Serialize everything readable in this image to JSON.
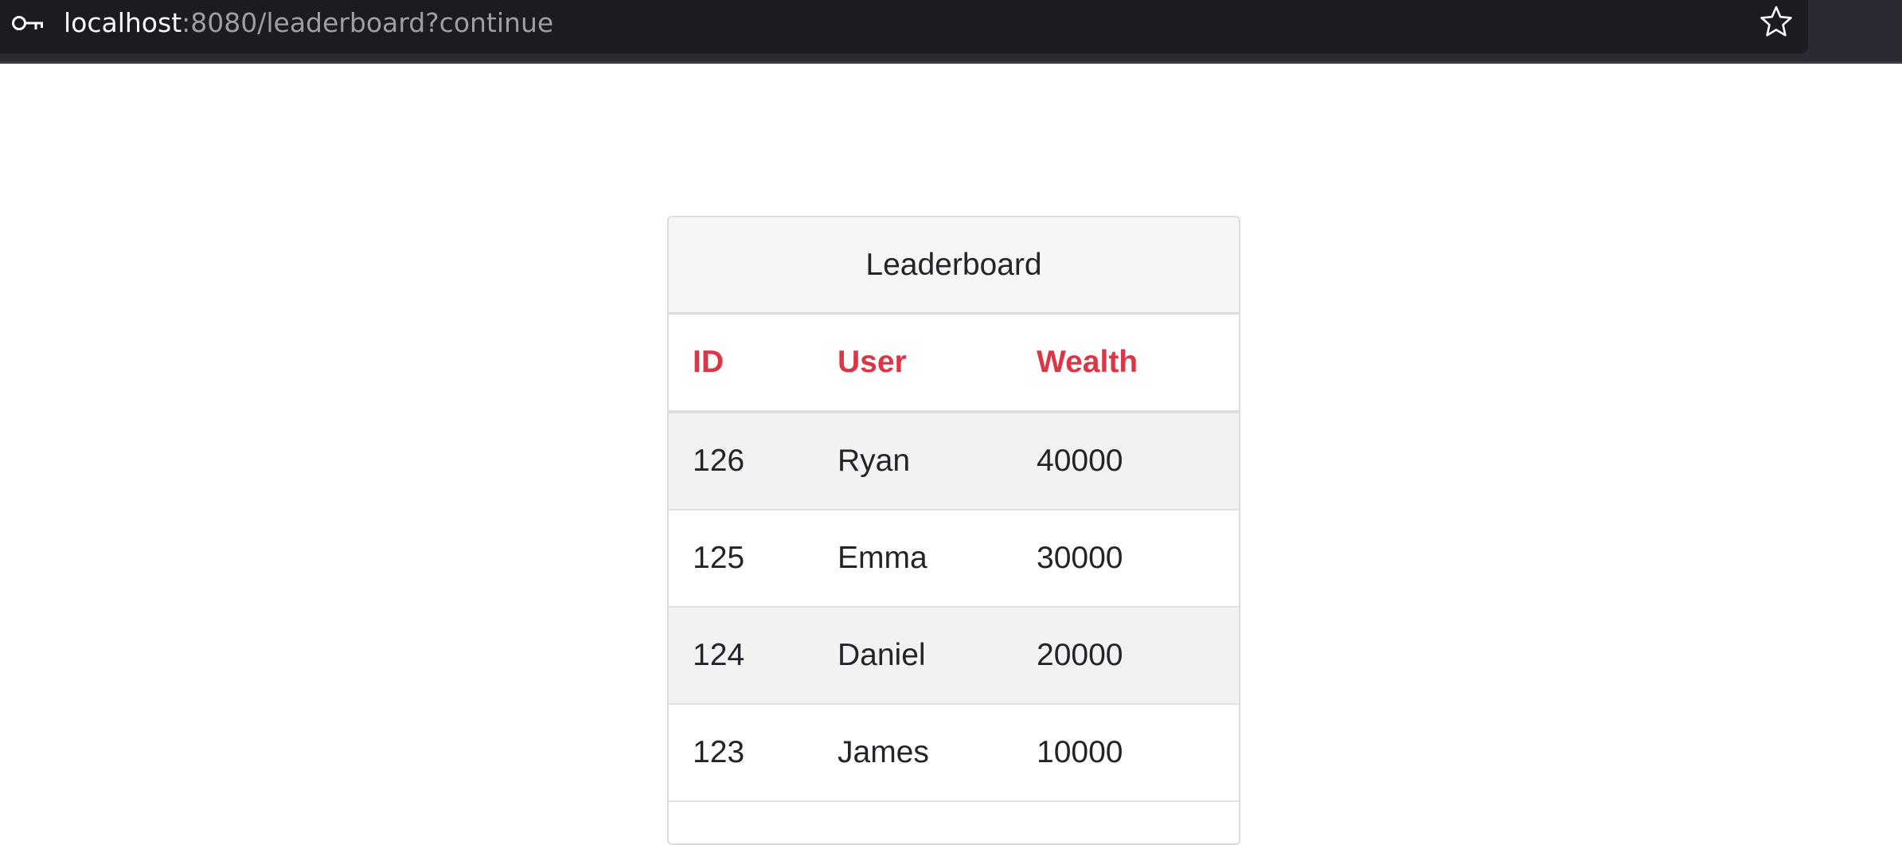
{
  "browser": {
    "url_host": "localhost",
    "url_rest": ":8080/leaderboard?continue"
  },
  "leaderboard": {
    "title": "Leaderboard",
    "columns": [
      "ID",
      "User",
      "Wealth"
    ],
    "rows": [
      {
        "id": "126",
        "user": "Ryan",
        "wealth": "40000"
      },
      {
        "id": "125",
        "user": "Emma",
        "wealth": "30000"
      },
      {
        "id": "124",
        "user": "Daniel",
        "wealth": "20000"
      },
      {
        "id": "123",
        "user": "James",
        "wealth": "10000"
      }
    ],
    "header_color": "#dc3545",
    "stripe_color": "#f2f2f2"
  }
}
